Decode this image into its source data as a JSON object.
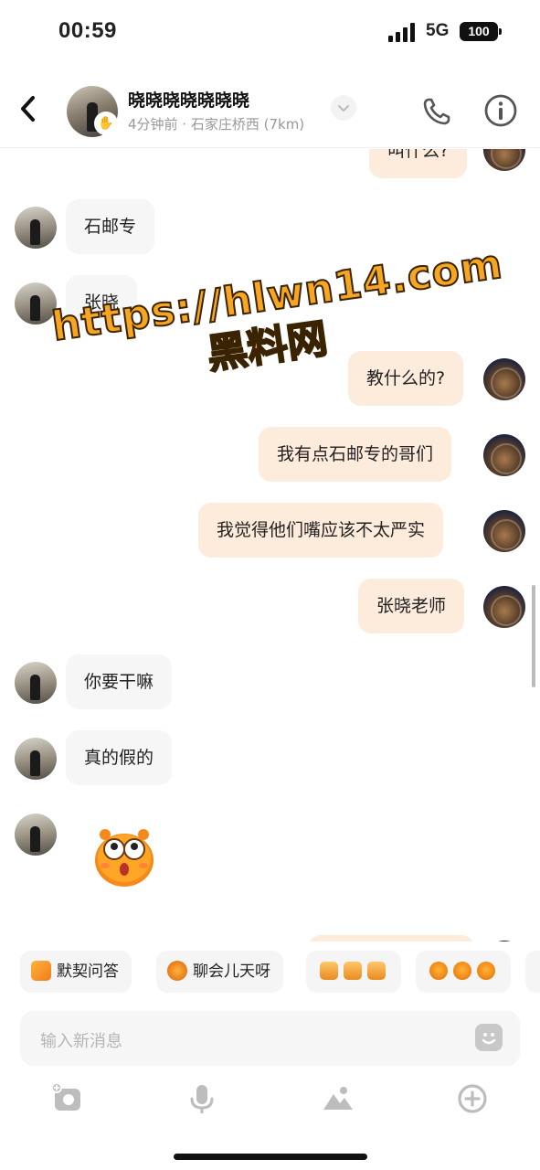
{
  "status_bar": {
    "time": "00:59",
    "network": "5G",
    "battery": "100"
  },
  "header": {
    "name": "晓晓晓晓晓晓晓",
    "subtitle": "4分钟前 · 石家庄桥西 (7km)"
  },
  "messages": [
    {
      "side": "out",
      "text": "叫什么?"
    },
    {
      "side": "in",
      "text": "石邮专"
    },
    {
      "side": "in",
      "text": "张晓"
    },
    {
      "side": "out",
      "text": "教什么的?"
    },
    {
      "side": "out",
      "text": "我有点石邮专的哥们"
    },
    {
      "side": "out",
      "text": "我觉得他们嘴应该不太严实"
    },
    {
      "side": "out",
      "text": "张晓老师"
    },
    {
      "side": "in",
      "text": "你要干嘛"
    },
    {
      "side": "in",
      "text": "真的假的"
    },
    {
      "side": "in",
      "type": "sticker",
      "icon": "surprised-face-sticker"
    }
  ],
  "watermark": {
    "url": "https://hlwn14.com",
    "name": "黑料网"
  },
  "quick_replies": [
    {
      "label": "默契问答",
      "icon": "quiz-icon"
    },
    {
      "label": "聊会儿天呀",
      "icon": "chat-sticker-icon"
    },
    {
      "label": "",
      "icon": "emoji-set-1"
    },
    {
      "label": "",
      "icon": "emoji-set-2"
    }
  ],
  "input": {
    "placeholder": "输入新消息"
  },
  "colors": {
    "outgoing_bubble": "#fdebdc",
    "incoming_bubble": "#f6f6f6",
    "watermark": "#f6a620"
  }
}
